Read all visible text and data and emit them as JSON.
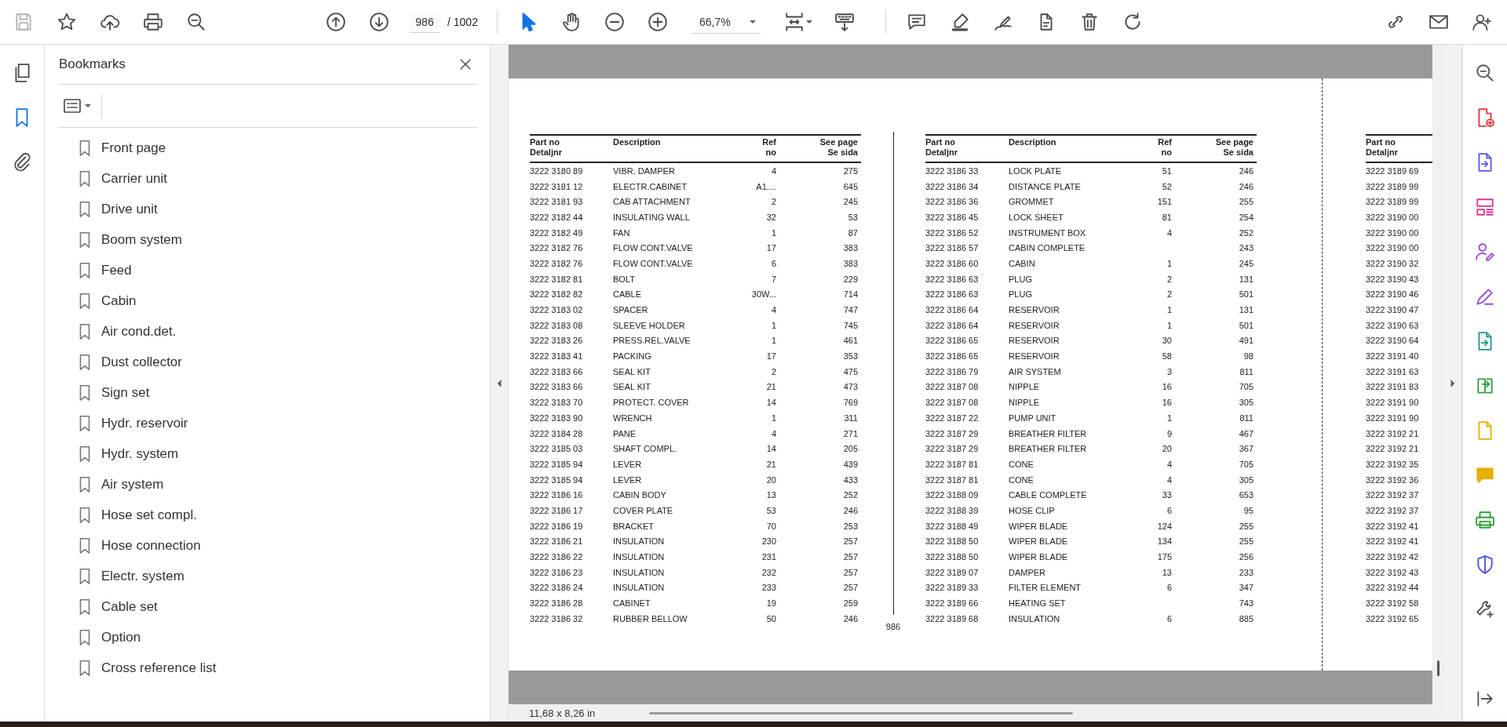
{
  "toolbar": {
    "page_number": "986",
    "page_count": "/ 1002",
    "zoom": "66,7%",
    "tools": [
      {
        "kind": "select",
        "selected": true
      },
      {
        "kind": "hand",
        "selected": false
      }
    ]
  },
  "side_rail": [
    {
      "kind": "pages",
      "selected": false
    },
    {
      "kind": "bookmarks",
      "selected": true
    },
    {
      "kind": "attachments",
      "selected": false
    }
  ],
  "bookmarks_panel": {
    "title": "Bookmarks",
    "items": [
      "Front page",
      "Carrier unit",
      "Drive unit",
      "Boom system",
      "Feed",
      "Cabin",
      "Air cond.det.",
      "Dust collector",
      "Sign set",
      "Hydr. reservoir",
      "Hydr. system",
      "Air system",
      "Hose set compl.",
      "Hose connection",
      "Electr. system",
      "Cable set",
      "Option",
      "Cross reference list"
    ]
  },
  "document": {
    "page_number": "986",
    "tables": [
      {
        "columns": [
          "Part no\nDetaljnr",
          "Description",
          "Ref\nno",
          "See page\nSe sida"
        ],
        "rows": [
          {
            "part": "3222 3180 89",
            "description": "VIBR. DAMPER",
            "ref": "4",
            "page": "275"
          },
          {
            "part": "3222 3181 12",
            "description": "ELECTR.CABINET",
            "ref": "A1....",
            "page": "645"
          },
          {
            "part": "3222 3181 93",
            "description": "CAB ATTACHMENT",
            "ref": "2",
            "page": "245"
          },
          {
            "part": "3222 3182 44",
            "description": "INSULATING WALL",
            "ref": "32",
            "page": "53"
          },
          {
            "part": "3222 3182 49",
            "description": "FAN",
            "ref": "1",
            "page": "87"
          },
          {
            "part": "3222 3182 76",
            "description": "FLOW CONT.VALVE",
            "ref": "17",
            "page": "383"
          },
          {
            "part": "3222 3182 76",
            "description": "FLOW CONT.VALVE",
            "ref": "6",
            "page": "383"
          },
          {
            "part": "3222 3182 81",
            "description": "BOLT",
            "ref": "7",
            "page": "229"
          },
          {
            "part": "3222 3182 82",
            "description": "CABLE",
            "ref": "30W...",
            "page": "714"
          },
          {
            "part": "3222 3183 02",
            "description": "SPACER",
            "ref": "4",
            "page": "747"
          },
          {
            "part": "3222 3183 08",
            "description": "SLEEVE HOLDER",
            "ref": "1",
            "page": "745"
          },
          {
            "part": "3222 3183 26",
            "description": "PRESS.REL.VALVE",
            "ref": "1",
            "page": "461"
          },
          {
            "part": "3222 3183 41",
            "description": "PACKING",
            "ref": "17",
            "page": "353"
          },
          {
            "part": "3222 3183 66",
            "description": "SEAL KIT",
            "ref": "2",
            "page": "475"
          },
          {
            "part": "3222 3183 66",
            "description": "SEAL KIT",
            "ref": "21",
            "page": "473"
          },
          {
            "part": "3222 3183 70",
            "description": "PROTECT. COVER",
            "ref": "14",
            "page": "769"
          },
          {
            "part": "3222 3183 90",
            "description": "WRENCH",
            "ref": "1",
            "page": "311"
          },
          {
            "part": "3222 3184 28",
            "description": "PANE",
            "ref": "4",
            "page": "271"
          },
          {
            "part": "3222 3185 03",
            "description": "SHAFT COMPL.",
            "ref": "14",
            "page": "205"
          },
          {
            "part": "3222 3185 94",
            "description": "LEVER",
            "ref": "21",
            "page": "439"
          },
          {
            "part": "3222 3185 94",
            "description": "LEVER",
            "ref": "20",
            "page": "433"
          },
          {
            "part": "3222 3186 16",
            "description": "CABIN BODY",
            "ref": "13",
            "page": "252"
          },
          {
            "part": "3222 3186 17",
            "description": "COVER PLATE",
            "ref": "53",
            "page": "246"
          },
          {
            "part": "3222 3186 19",
            "description": "BRACKET",
            "ref": "70",
            "page": "253"
          },
          {
            "part": "3222 3186 21",
            "description": "INSULATION",
            "ref": "230",
            "page": "257"
          },
          {
            "part": "3222 3186 22",
            "description": "INSULATION",
            "ref": "231",
            "page": "257"
          },
          {
            "part": "3222 3186 23",
            "description": "INSULATION",
            "ref": "232",
            "page": "257"
          },
          {
            "part": "3222 3186 24",
            "description": "INSULATION",
            "ref": "233",
            "page": "257"
          },
          {
            "part": "3222 3186 28",
            "description": "CABINET",
            "ref": "19",
            "page": "259"
          },
          {
            "part": "3222 3186 32",
            "description": "RUBBER BELLOW",
            "ref": "50",
            "page": "246"
          }
        ]
      },
      {
        "columns": [
          "Part no\nDetaljnr",
          "Description",
          "Ref\nno",
          "See page\nSe sida"
        ],
        "rows": [
          {
            "part": "3222 3186 33",
            "description": "LOCK PLATE",
            "ref": "51",
            "page": "246"
          },
          {
            "part": "3222 3186 34",
            "description": "DISTANCE PLATE",
            "ref": "52",
            "page": "246"
          },
          {
            "part": "3222 3186 36",
            "description": "GROMMET",
            "ref": "151",
            "page": "255"
          },
          {
            "part": "3222 3186 45",
            "description": "LOCK SHEET",
            "ref": "81",
            "page": "254"
          },
          {
            "part": "3222 3186 52",
            "description": "INSTRUMENT BOX",
            "ref": "4",
            "page": "252"
          },
          {
            "part": "3222 3186 57",
            "description": "CABIN COMPLETE",
            "page": "243"
          },
          {
            "part": "3222 3186 60",
            "description": "CABIN",
            "ref": "1",
            "page": "245"
          },
          {
            "part": "3222 3186 63",
            "description": "PLUG",
            "ref": "2",
            "page": "131"
          },
          {
            "part": "3222 3186 63",
            "description": "PLUG",
            "ref": "2",
            "page": "501"
          },
          {
            "part": "3222 3186 64",
            "description": "RESERVOIR",
            "ref": "1",
            "page": "131"
          },
          {
            "part": "3222 3186 64",
            "description": "RESERVOIR",
            "ref": "1",
            "page": "501"
          },
          {
            "part": "3222 3186 65",
            "description": "RESERVOIR",
            "ref": "30",
            "page": "491"
          },
          {
            "part": "3222 3186 65",
            "description": "RESERVOIR",
            "ref": "58",
            "page": "98"
          },
          {
            "part": "3222 3186 79",
            "description": "AIR SYSTEM",
            "ref": "3",
            "page": "811"
          },
          {
            "part": "3222 3187 08",
            "description": "NIPPLE",
            "ref": "16",
            "page": "705"
          },
          {
            "part": "3222 3187 08",
            "description": "NIPPLE",
            "ref": "16",
            "page": "305"
          },
          {
            "part": "3222 3187 22",
            "description": "PUMP UNIT",
            "ref": "1",
            "page": "811"
          },
          {
            "part": "3222 3187 29",
            "description": "BREATHER FILTER",
            "ref": "9",
            "page": "467"
          },
          {
            "part": "3222 3187 29",
            "description": "BREATHER FILTER",
            "ref": "20",
            "page": "367"
          },
          {
            "part": "3222 3187 81",
            "description": "CONE",
            "ref": "4",
            "page": "705"
          },
          {
            "part": "3222 3187 81",
            "description": "CONE",
            "ref": "4",
            "page": "305"
          },
          {
            "part": "3222 3188 09",
            "description": "CABLE COMPLETE",
            "ref": "33",
            "page": "653"
          },
          {
            "part": "3222 3188 39",
            "description": "HOSE CLIP",
            "ref": "6",
            "page": "95"
          },
          {
            "part": "3222 3188 49",
            "description": "WIPER BLADE",
            "ref": "124",
            "page": "255"
          },
          {
            "part": "3222 3188 50",
            "description": "WIPER BLADE",
            "ref": "134",
            "page": "255"
          },
          {
            "part": "3222 3188 50",
            "description": "WIPER BLADE",
            "ref": "175",
            "page": "256"
          },
          {
            "part": "3222 3189 07",
            "description": "DAMPER",
            "ref": "13",
            "page": "233"
          },
          {
            "part": "3222 3189 33",
            "description": "FILTER ELEMENT",
            "ref": "6",
            "page": "347"
          },
          {
            "part": "3222 3189 66",
            "description": "HEATING SET",
            "page": "743"
          },
          {
            "part": "3222 3189 68",
            "description": "INSULATION",
            "ref": "6",
            "page": "885"
          }
        ]
      },
      {
        "columns": [
          "Part no\nDetaljnr"
        ],
        "rows": [
          {
            "part": "3222 3189 69"
          },
          {
            "part": "3222 3189 99"
          },
          {
            "part": "3222 3189 99"
          },
          {
            "part": "3222 3190 00"
          },
          {
            "part": "3222 3190 00"
          },
          {
            "part": "3222 3190 00"
          },
          {
            "part": "3222 3190 32"
          },
          {
            "part": "3222 3190 43"
          },
          {
            "part": "3222 3190 46"
          },
          {
            "part": "3222 3190 47"
          },
          {
            "part": "3222 3190 63"
          },
          {
            "part": "3222 3190 64"
          },
          {
            "part": "3222 3191 40"
          },
          {
            "part": "3222 3191 63"
          },
          {
            "part": "3222 3191 83"
          },
          {
            "part": "3222 3191 90"
          },
          {
            "part": "3222 3191 90"
          },
          {
            "part": "3222 3192 21"
          },
          {
            "part": "3222 3192 21"
          },
          {
            "part": "3222 3192 35"
          },
          {
            "part": "3222 3192 36"
          },
          {
            "part": "3222 3192 37"
          },
          {
            "part": "3222 3192 37"
          },
          {
            "part": "3222 3192 41"
          },
          {
            "part": "3222 3192 41"
          },
          {
            "part": "3222 3192 42"
          },
          {
            "part": "3222 3192 43"
          },
          {
            "part": "3222 3192 44"
          },
          {
            "part": "3222 3192 58"
          },
          {
            "part": "3222 3192 65"
          }
        ]
      }
    ]
  },
  "status_bar": {
    "page_size": "11,68 x 8,26 in"
  }
}
